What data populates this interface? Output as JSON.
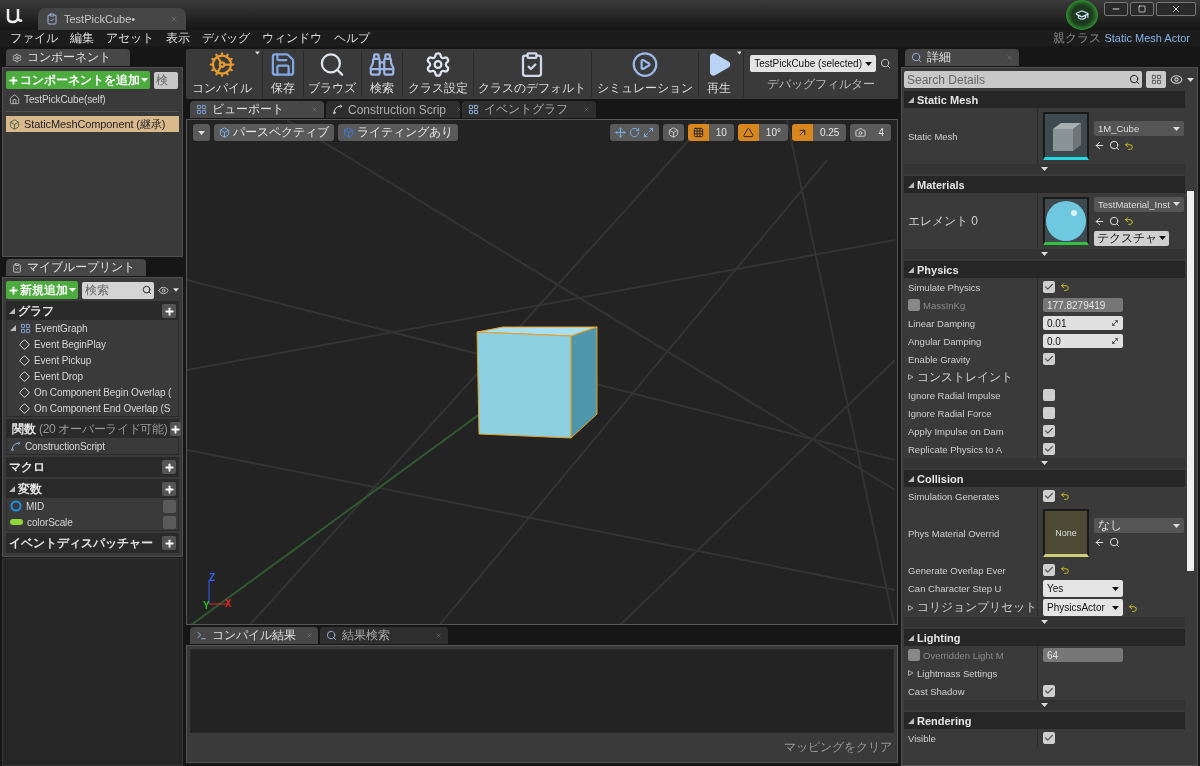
{
  "window": {
    "document_tab": "TestPickCube•",
    "parent_class_label": "親クラス",
    "parent_class": "Static Mesh Actor"
  },
  "menu": [
    "ファイル",
    "編集",
    "アセット",
    "表示",
    "デバッグ",
    "ウィンドウ",
    "ヘルプ"
  ],
  "components": {
    "tab": "コンポーネント",
    "add_button": "コンポーネントを追加",
    "search": {
      "placeholder": "検"
    },
    "items": [
      {
        "label": "TestPickCube(self)",
        "kind": "actor",
        "selected": false
      },
      {
        "label": "StaticMeshComponent (継承)",
        "kind": "mesh",
        "selected": true
      }
    ]
  },
  "my_blueprint": {
    "tab": "マイブループリント",
    "add_button": "新規追加",
    "search": {
      "placeholder": "検索"
    },
    "sections": [
      {
        "title": "グラフ",
        "items": [
          {
            "label": "EventGraph",
            "kind": "graph",
            "children": [
              {
                "label": "Event BeginPlay",
                "kind": "event"
              },
              {
                "label": "Event Pickup",
                "kind": "event"
              },
              {
                "label": "Event Drop",
                "kind": "event"
              },
              {
                "label": "On Component Begin Overlap (",
                "kind": "event"
              },
              {
                "label": "On Component End Overlap (S",
                "kind": "event"
              }
            ]
          }
        ]
      },
      {
        "title": "関数",
        "note": "(20 オーバーライド可能)",
        "items": [
          {
            "label": "ConstructionScript",
            "kind": "function"
          }
        ]
      },
      {
        "title": "マクロ"
      },
      {
        "title": "変数",
        "items": [
          {
            "label": "MID",
            "kind": "object",
            "color": "#1a8fe0"
          },
          {
            "label": "colorScale",
            "kind": "float",
            "color": "#8cd63c"
          }
        ]
      },
      {
        "title": "イベントディスパッチャー"
      }
    ]
  },
  "toolbar": {
    "buttons": [
      {
        "label": "コンパイル",
        "kind": "compile",
        "menu": true
      },
      {
        "label": "保存",
        "kind": "save",
        "menu": false
      },
      {
        "label": "ブラウズ",
        "kind": "browse",
        "menu": false
      },
      {
        "label": "検索",
        "kind": "find",
        "menu": false
      },
      {
        "label": "クラス設定",
        "kind": "class_settings",
        "menu": false
      },
      {
        "label": "クラスのデフォルト",
        "kind": "class_defaults",
        "menu": false
      },
      {
        "label": "シミュレーション",
        "kind": "simulate",
        "menu": false
      },
      {
        "label": "再生",
        "kind": "play",
        "menu": true
      }
    ],
    "debug_filter": {
      "value": "TestPickCube (selected)",
      "label": "デバッグフィルター"
    }
  },
  "editor_tabs": [
    {
      "label": "ビューポート",
      "kind": "viewport",
      "selected": true
    },
    {
      "label": "Construction Scrip",
      "kind": "function",
      "selected": false
    },
    {
      "label": "イベントグラフ",
      "kind": "graph",
      "selected": false
    }
  ],
  "viewport": {
    "view_mode": "パースペクティブ",
    "lighting": "ライティングあり",
    "snaps": [
      {
        "kind": "grid",
        "value": "10",
        "on": true
      },
      {
        "kind": "rotation",
        "value": "10°",
        "on": true
      },
      {
        "kind": "scale",
        "value": "0.25",
        "on": true
      },
      {
        "kind": "camera_speed",
        "value": "4",
        "on": false
      }
    ],
    "axes": [
      "Z",
      "Y",
      "X"
    ]
  },
  "output": {
    "tabs": [
      {
        "label": "コンパイル結果",
        "kind": "log",
        "selected": true
      },
      {
        "label": "結果検索",
        "kind": "search",
        "selected": false
      }
    ],
    "clear_button": "マッピングをクリア"
  },
  "details": {
    "tab": "詳細",
    "search": {
      "placeholder": "Search Details"
    },
    "sections": [
      {
        "title": "Static Mesh",
        "rows": [
          {
            "kind": "asset",
            "label": "Static Mesh",
            "value": "1M_Cube",
            "thumbnail": {
              "kind": "mesh"
            },
            "reset": true
          }
        ]
      },
      {
        "title": "Materials",
        "rows": [
          {
            "kind": "asset",
            "label": "エレメント 0",
            "value": "TestMaterial_Inst",
            "thumbnail": {
              "kind": "sphere"
            },
            "reset": true,
            "button": "テクスチャ"
          }
        ]
      },
      {
        "title": "Physics",
        "rows": [
          {
            "kind": "check",
            "label": "Simulate Physics",
            "checked": true,
            "reset": true
          },
          {
            "kind": "override",
            "label": "MassInKg",
            "checked": false,
            "value": "177.8279419"
          },
          {
            "kind": "number",
            "label": "Linear Damping",
            "value": "0.01"
          },
          {
            "kind": "number",
            "label": "Angular Damping",
            "value": "0.0"
          },
          {
            "kind": "check",
            "label": "Enable Gravity",
            "checked": true,
            "reset": false
          },
          {
            "kind": "group",
            "label": "コンストレイント"
          },
          {
            "kind": "check",
            "label": "Ignore Radial Impulse",
            "checked": false,
            "reset": false
          },
          {
            "kind": "check",
            "label": "Ignore Radial Force",
            "checked": false,
            "reset": false
          },
          {
            "kind": "check",
            "label": "Apply Impulse on Dam",
            "checked": true,
            "reset": false
          },
          {
            "kind": "check",
            "label": "Replicate Physics to A",
            "checked": true,
            "reset": false
          }
        ]
      },
      {
        "title": "Collision",
        "rows": [
          {
            "kind": "check",
            "label": "Simulation Generates",
            "checked": true,
            "reset": true
          },
          {
            "kind": "asset",
            "label": "Phys Material Overrid",
            "value": "なし",
            "thumbnail": {
              "kind": "none",
              "text": "None"
            },
            "reset": false
          },
          {
            "kind": "check",
            "label": "Generate Overlap Ever",
            "checked": true,
            "reset": true
          },
          {
            "kind": "dropdown",
            "label": "Can Character Step U",
            "value": "Yes",
            "expandable": false,
            "reset": false
          },
          {
            "kind": "dropdown",
            "label": "コリジョンプリセット",
            "value": "PhysicsActor",
            "expandable": true,
            "reset": true
          }
        ]
      },
      {
        "title": "Lighting",
        "rows": [
          {
            "kind": "override",
            "label": "Overridden Light M",
            "checked": false,
            "value": "64"
          },
          {
            "kind": "group",
            "label": "Lightmass Settings"
          },
          {
            "kind": "check",
            "label": "Cast Shadow",
            "checked": true,
            "reset": false
          }
        ]
      },
      {
        "title": "Rendering",
        "rows": [
          {
            "kind": "check",
            "label": "Visible",
            "checked": true,
            "reset": false
          }
        ]
      }
    ]
  }
}
